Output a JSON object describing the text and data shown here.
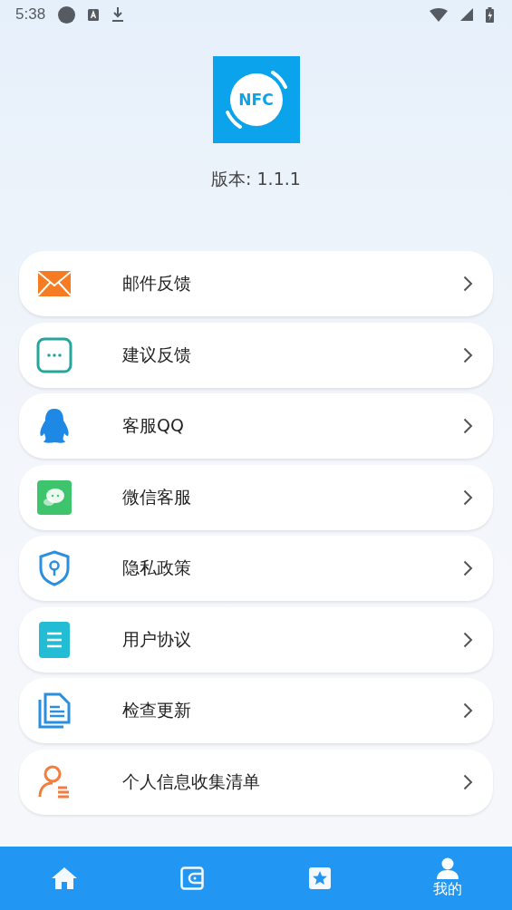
{
  "status_bar": {
    "time": "5:38"
  },
  "app": {
    "logo_text": "NFC",
    "version": "版本: 1.1.1"
  },
  "menu": [
    {
      "label": "邮件反馈"
    },
    {
      "label": "建议反馈"
    },
    {
      "label": "客服QQ"
    },
    {
      "label": "微信客服"
    },
    {
      "label": "隐私政策"
    },
    {
      "label": "用户协议"
    },
    {
      "label": "检查更新"
    },
    {
      "label": "个人信息收集清单"
    }
  ],
  "bottom_nav": [
    {
      "selected": false
    },
    {
      "selected": false
    },
    {
      "selected": false
    },
    {
      "label": "我的",
      "selected": true
    }
  ]
}
